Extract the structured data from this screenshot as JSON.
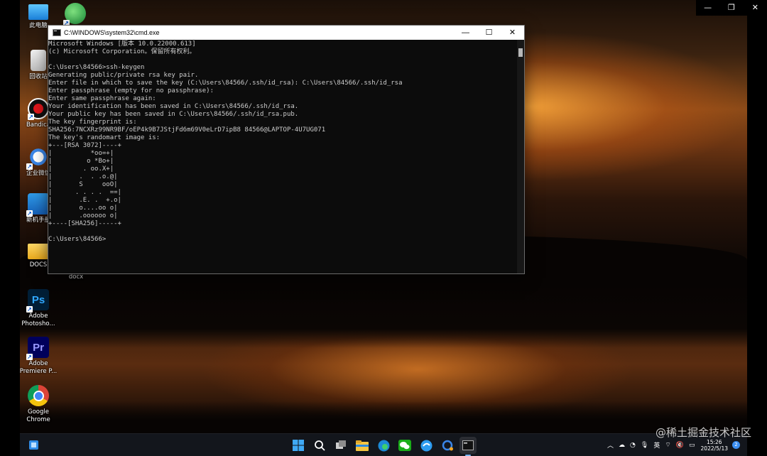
{
  "desktop": {
    "icons": [
      {
        "label": "此电脑"
      },
      {
        "label": ""
      },
      {
        "label": "回收站"
      },
      {
        "label": "Bandica"
      },
      {
        "label": "企业微信"
      },
      {
        "label": "新机手册"
      },
      {
        "label": "DOCS"
      },
      {
        "label": "docx"
      },
      {
        "label": "Adobe\nPhotosho..."
      },
      {
        "label": "Adobe\nPremiere P..."
      },
      {
        "label": "Google\nChrome"
      }
    ]
  },
  "remote_controls": {
    "minimize": "—",
    "restore": "❐",
    "close": "✕"
  },
  "cmd": {
    "title": "C:\\WINDOWS\\system32\\cmd.exe",
    "lines": [
      "Microsoft Windows [版本 10.0.22000.613]",
      "(c) Microsoft Corporation。保留所有权利。",
      "",
      "C:\\Users\\84566>ssh-keygen",
      "Generating public/private rsa key pair.",
      "Enter file in which to save the key (C:\\Users\\84566/.ssh/id_rsa): C:\\Users\\84566/.ssh/id_rsa",
      "Enter passphrase (empty for no passphrase):",
      "Enter same passphrase again:",
      "Your identification has been saved in C:\\Users\\84566/.ssh/id_rsa.",
      "Your public key has been saved in C:\\Users\\84566/.ssh/id_rsa.pub.",
      "The key fingerprint is:",
      "SHA256:7NCXRz99NR9BF/oEP4k9B7JStjFd6m69V0eLrD7ipB8 84566@LAPTOP-4U7UG071",
      "The key's randomart image is:",
      "+---[RSA 3072]----+",
      "|          *oo=+|",
      "|         o *Bo+|",
      "|        . oo.X+|",
      "|       .  . .o.@|",
      "|       S     ooO|",
      "|      . . . .  ==|",
      "|       .E. .  +.o|",
      "|       o....oo o|",
      "|       .oooooo o|",
      "+----[SHA256]-----+",
      "",
      "C:\\Users\\84566>"
    ]
  },
  "taskbar": {
    "apps": [
      {
        "icon": "windows-start-icon"
      },
      {
        "icon": "search-icon"
      },
      {
        "icon": "task-view-icon"
      },
      {
        "icon": "file-explorer-icon"
      },
      {
        "icon": "edge-icon"
      },
      {
        "icon": "wechat-icon"
      },
      {
        "icon": "browser-icon"
      },
      {
        "icon": "wecom-icon"
      },
      {
        "icon": "terminal-icon"
      }
    ],
    "tray": {
      "ime": "英",
      "time": "15:26",
      "date": "2022/5/13",
      "notifications": "2"
    }
  },
  "watermark": "@稀土掘金技术社区",
  "colors": {
    "terminal_bg": "#0c0c0c",
    "terminal_fg": "#cccccc",
    "accent": "#3b8ef0"
  }
}
